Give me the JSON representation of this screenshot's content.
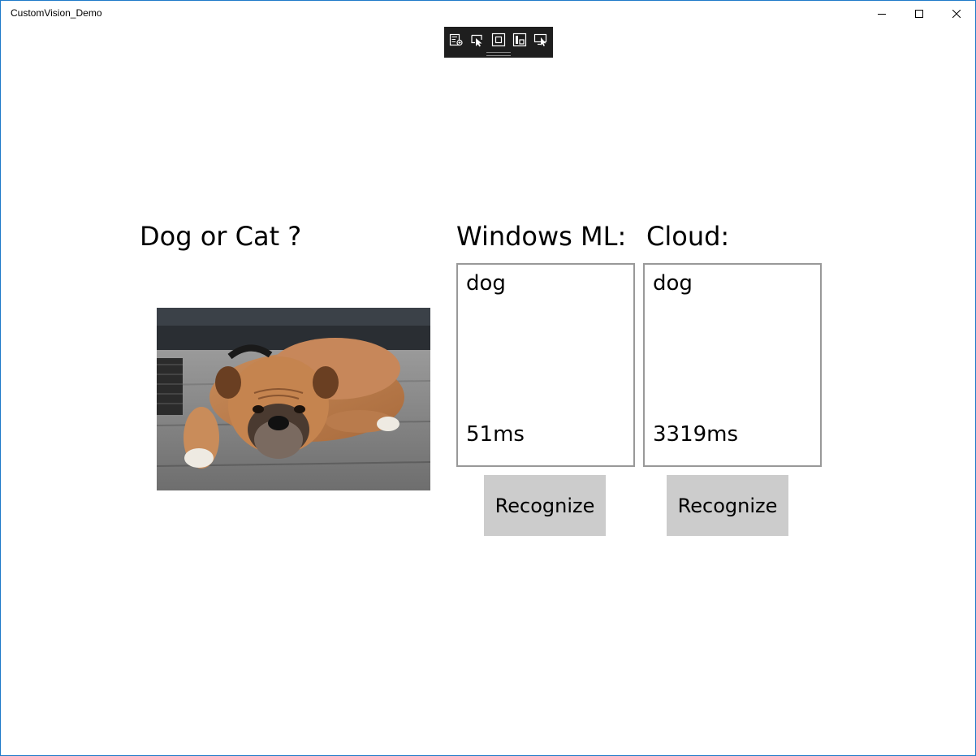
{
  "window": {
    "title": "CustomVision_Demo",
    "accent_color": "#1f7ac9"
  },
  "caption_buttons": {
    "minimize_icon": "minimize-icon",
    "maximize_icon": "maximize-icon",
    "close_icon": "close-icon"
  },
  "debug_toolbar": {
    "background": "#1e1e1e",
    "items": [
      {
        "icon": "live-visual-tree-icon"
      },
      {
        "icon": "select-element-icon"
      },
      {
        "icon": "display-layout-adorners-icon"
      },
      {
        "icon": "track-focus-icon"
      },
      {
        "icon": "preview-selection-icon"
      }
    ]
  },
  "main": {
    "title": "Dog or Cat ?",
    "image": {
      "subject": "bulldog lying on wooden floor",
      "icon": "dog-photo"
    }
  },
  "panels": [
    {
      "heading": "Windows ML:",
      "result_label": "dog",
      "time": "51ms",
      "button_label": "Recognize"
    },
    {
      "heading": "Cloud:",
      "result_label": "dog",
      "time": "3319ms",
      "button_label": "Recognize"
    }
  ],
  "colors": {
    "button_bg": "#cccccc",
    "box_border": "#999999"
  }
}
